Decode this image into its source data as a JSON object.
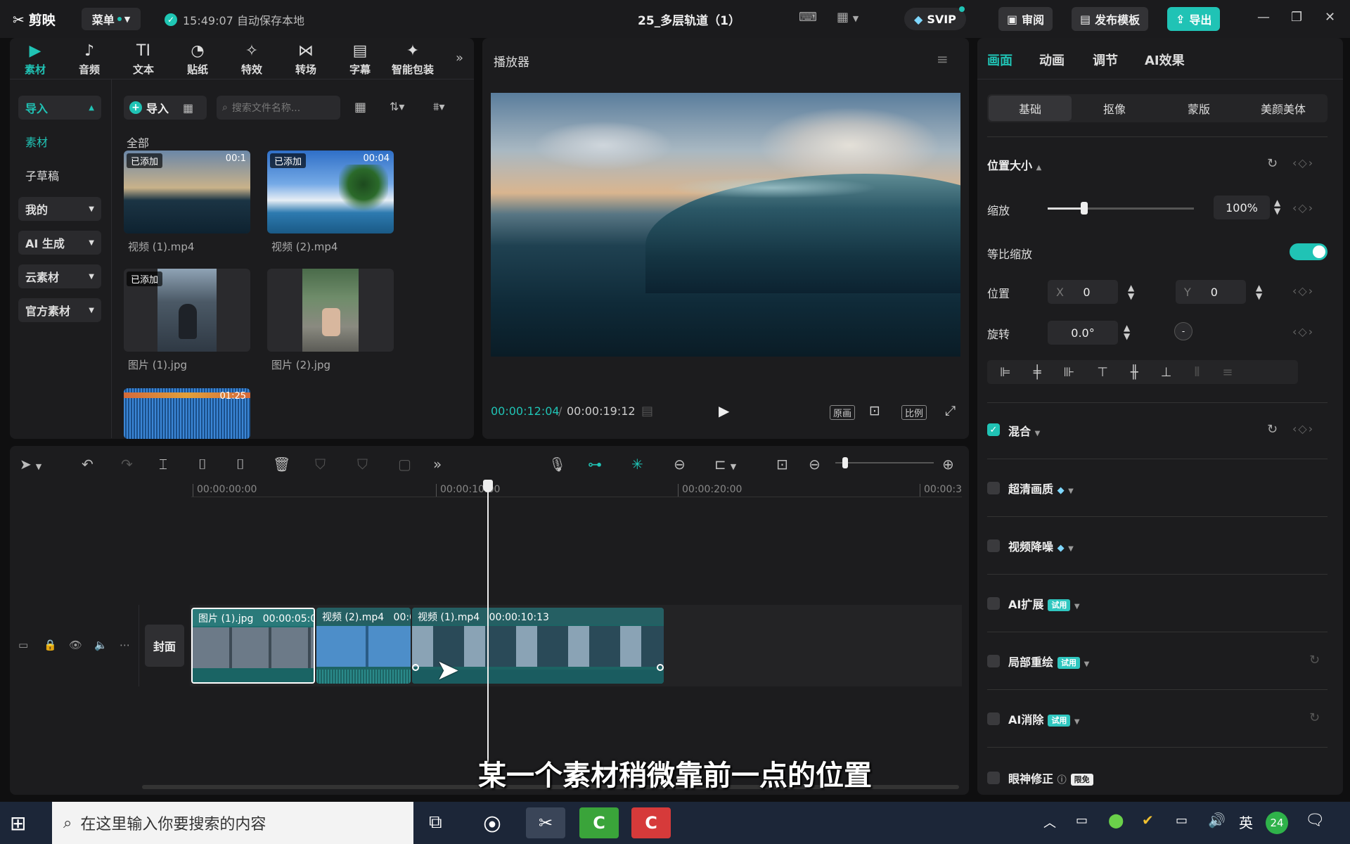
{
  "titlebar": {
    "app_name": "剪映",
    "menu_label": "菜单",
    "save_status": "15:49:07 自动保存本地",
    "project_title": "25_多层轨道（1）",
    "svip_label": "SVIP",
    "review_label": "审阅",
    "publish_label": "发布模板",
    "export_label": "导出"
  },
  "media_tabs": [
    {
      "label": "素材",
      "icon": "▶"
    },
    {
      "label": "音频",
      "icon": "♪"
    },
    {
      "label": "文本",
      "icon": "TI"
    },
    {
      "label": "贴纸",
      "icon": "◔"
    },
    {
      "label": "特效",
      "icon": "✧"
    },
    {
      "label": "转场",
      "icon": "⋈"
    },
    {
      "label": "字幕",
      "icon": "▤"
    },
    {
      "label": "智能包装",
      "icon": "✦"
    }
  ],
  "sidebar": {
    "items": [
      {
        "label": "导入"
      },
      {
        "label": "素材"
      },
      {
        "label": "子草稿"
      },
      {
        "label": "我的"
      },
      {
        "label": "AI 生成"
      },
      {
        "label": "云素材"
      },
      {
        "label": "官方素材"
      }
    ]
  },
  "library": {
    "import_label": "导入",
    "search_placeholder": "搜索文件名称...",
    "section_all": "全部",
    "items": [
      {
        "name": "视频 (1).mp4",
        "badge": "已添加",
        "duration": "00:1"
      },
      {
        "name": "视频 (2).mp4",
        "badge": "已添加",
        "duration": "00:04"
      },
      {
        "name": "图片 (1).jpg",
        "badge": "已添加",
        "duration": ""
      },
      {
        "name": "图片 (2).jpg",
        "badge": "",
        "duration": ""
      },
      {
        "name": "",
        "badge": "",
        "duration": "01:25"
      }
    ]
  },
  "player": {
    "title": "播放器",
    "current_time": "00:00:12:04",
    "total_time": "00:00:19:12",
    "btn_original": "原画",
    "btn_ratio": "比例"
  },
  "timeline": {
    "ruler": [
      "00:00:00:00",
      "00:00:10:00",
      "00:00:20:00",
      "00:00:3"
    ],
    "cover_label": "封面",
    "clips": [
      {
        "name": "图片 (1).jpg",
        "duration": "00:00:05:0"
      },
      {
        "name": "视频 (2).mp4",
        "duration": "00:0"
      },
      {
        "name": "视频 (1).mp4",
        "duration": "00:00:10:13"
      }
    ]
  },
  "inspector": {
    "tabs": [
      "画面",
      "动画",
      "调节",
      "AI效果"
    ],
    "subtabs": [
      "基础",
      "抠像",
      "蒙版",
      "美颜美体"
    ],
    "section_position": "位置大小",
    "scale_label": "缩放",
    "scale_value": "100%",
    "scale_level": 0.25,
    "proportional_label": "等比缩放",
    "position_label": "位置",
    "pos_x_label": "X",
    "pos_x": "0",
    "pos_y_label": "Y",
    "pos_y": "0",
    "rotation_label": "旋转",
    "rotation_value": "0.0°",
    "blend_label": "混合",
    "options": [
      {
        "label": "超清画质",
        "tag": ""
      },
      {
        "label": "视频降噪",
        "tag": ""
      },
      {
        "label": "AI扩展",
        "tag": "试用"
      },
      {
        "label": "局部重绘",
        "tag": "试用"
      },
      {
        "label": "AI消除",
        "tag": "试用"
      },
      {
        "label": "眼神修正",
        "tag": "限免"
      }
    ]
  },
  "subtitle_text": "某一个素材稍微靠前一点的位置",
  "taskbar": {
    "search_placeholder": "在这里输入你要搜索的内容",
    "lang": "英",
    "notif_count": "24"
  },
  "colors": {
    "accent": "#20c3b5",
    "bg": "#0f0f10",
    "panel": "#1c1c1e"
  }
}
